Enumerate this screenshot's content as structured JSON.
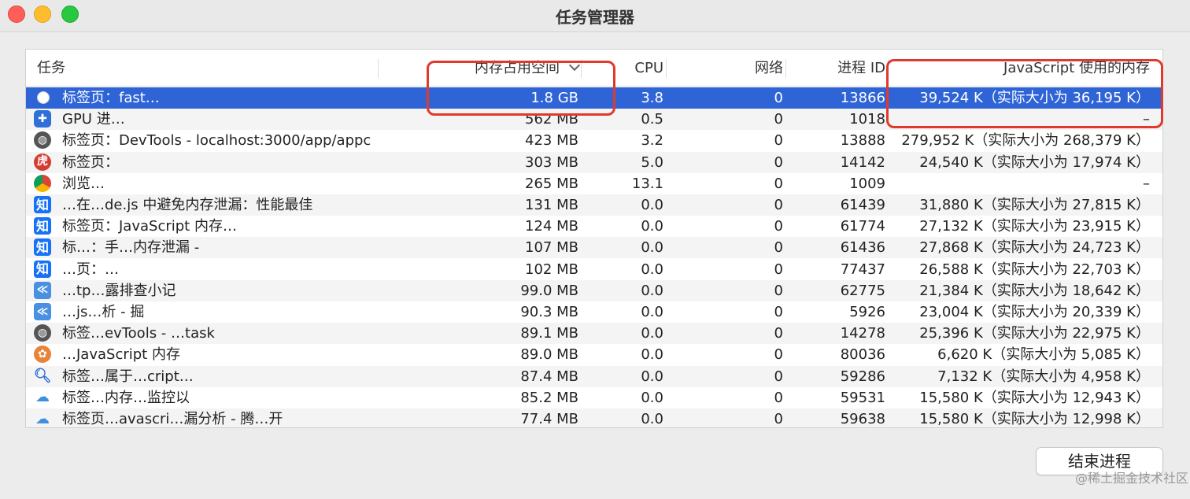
{
  "window": {
    "title": "任务管理器"
  },
  "columns": {
    "task": "任务",
    "memory": "内存占用空间",
    "cpu": "CPU",
    "network": "网络",
    "pid": "进程 ID",
    "js_memory": "JavaScript 使用的内存"
  },
  "sort": {
    "column": "memory",
    "direction": "descending",
    "icon": "chevron-down-icon"
  },
  "rows": [
    {
      "icon": "favicon",
      "task": "标签页：fast…",
      "memory": "1.8 GB",
      "cpu": "3.8",
      "network": "0",
      "pid": "13866",
      "js_memory": "39,524 K（实际大小为 36,195 K）",
      "selected": true
    },
    {
      "icon": "puzzle",
      "task": "GPU 进…",
      "memory": "562 MB",
      "cpu": "0.5",
      "network": "0",
      "pid": "1018",
      "js_memory": "–"
    },
    {
      "icon": "globe",
      "task": "标签页：DevTools - localhost:3000/app/appc",
      "memory": "423 MB",
      "cpu": "3.2",
      "network": "0",
      "pid": "13888",
      "js_memory": "279,952 K（实际大小为 268,379 K）"
    },
    {
      "icon": "tiger",
      "task": "标签页：",
      "memory": "303 MB",
      "cpu": "5.0",
      "network": "0",
      "pid": "14142",
      "js_memory": "24,540 K（实际大小为 17,974 K）"
    },
    {
      "icon": "chrome",
      "task": "浏览…",
      "memory": "265 MB",
      "cpu": "13.1",
      "network": "0",
      "pid": "1009",
      "js_memory": "–"
    },
    {
      "icon": "zhi",
      "task": "…在…de.js 中避免内存泄漏：性能最佳",
      "memory": "131 MB",
      "cpu": "0.0",
      "network": "0",
      "pid": "61439",
      "js_memory": "31,880 K（实际大小为 27,815 K）"
    },
    {
      "icon": "zhi",
      "task": "标签页：JavaScript 内存…",
      "memory": "124 MB",
      "cpu": "0.0",
      "network": "0",
      "pid": "61774",
      "js_memory": "27,132 K（实际大小为 23,915 K）"
    },
    {
      "icon": "zhi",
      "task": "标…：手…内存泄漏 -",
      "memory": "107 MB",
      "cpu": "0.0",
      "network": "0",
      "pid": "61436",
      "js_memory": "27,868 K（实际大小为 24,723 K）"
    },
    {
      "icon": "zhi",
      "task": "…页：…",
      "memory": "102 MB",
      "cpu": "0.0",
      "network": "0",
      "pid": "77437",
      "js_memory": "26,588 K（实际大小为 22,703 K）"
    },
    {
      "icon": "ln",
      "task": "…tp…露排查小记",
      "memory": "99.0 MB",
      "cpu": "0.0",
      "network": "0",
      "pid": "62775",
      "js_memory": "21,384 K（实际大小为 18,642 K）"
    },
    {
      "icon": "ln",
      "task": "…js…析 - 掘",
      "memory": "90.3 MB",
      "cpu": "0.0",
      "network": "0",
      "pid": "5926",
      "js_memory": "23,004 K（实际大小为 20,339 K）"
    },
    {
      "icon": "globe",
      "task": "标签…evTools - …task",
      "memory": "89.1 MB",
      "cpu": "0.0",
      "network": "0",
      "pid": "14278",
      "js_memory": "25,396 K（实际大小为 22,975 K）"
    },
    {
      "icon": "orange",
      "task": "…JavaScript 内存",
      "memory": "89.0 MB",
      "cpu": "0.0",
      "network": "0",
      "pid": "80036",
      "js_memory": "6,620 K（实际大小为 5,085 K）"
    },
    {
      "icon": "mag",
      "task": "标签…属于…cript…",
      "memory": "87.4 MB",
      "cpu": "0.0",
      "network": "0",
      "pid": "59286",
      "js_memory": "7,132 K（实际大小为 4,958 K）"
    },
    {
      "icon": "cloud",
      "task": "标签…内存…监控以",
      "memory": "85.2 MB",
      "cpu": "0.0",
      "network": "0",
      "pid": "59531",
      "js_memory": "15,580 K（实际大小为 12,943 K）"
    },
    {
      "icon": "cloud",
      "task": "标签页…avascri…漏分析 - 腾…开",
      "memory": "77.4 MB",
      "cpu": "0.0",
      "network": "0",
      "pid": "59638",
      "js_memory": "15,580 K（实际大小为 12,998 K）"
    }
  ],
  "buttons": {
    "end_process": "结束进程"
  },
  "watermark": "@稀土掘金技术社区",
  "colors": {
    "selection": "#2f64d6",
    "highlight_box": "#e03a2c"
  }
}
